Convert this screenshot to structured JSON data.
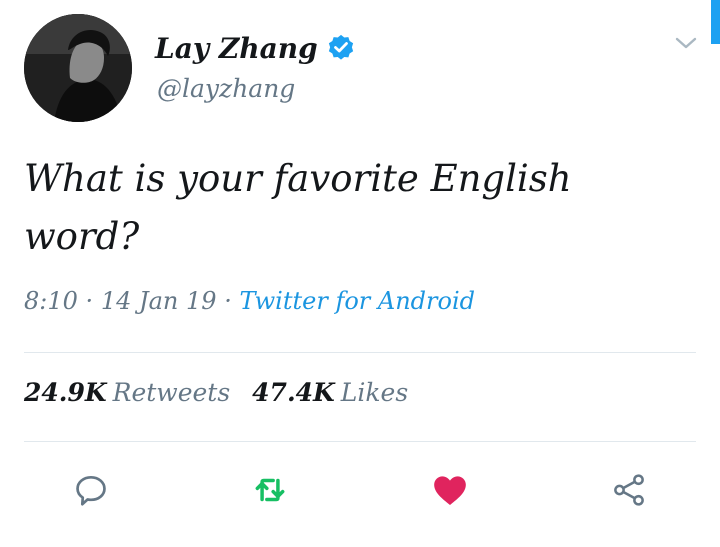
{
  "tweet": {
    "author": {
      "display_name": "Lay Zhang",
      "handle": "@layzhang",
      "verified": true,
      "avatar_icon": "profile-photo"
    },
    "text": "What is your favorite English word?",
    "time": "8:10",
    "date": "14 Jan 19",
    "separator": "·",
    "source": "Twitter for Android",
    "stats": {
      "retweets_count": "24.9K",
      "retweets_label": "Retweets",
      "likes_count": "47.4K",
      "likes_label": "Likes"
    },
    "liked": true
  },
  "actions": [
    {
      "name": "reply",
      "icon": "speech-bubble-icon"
    },
    {
      "name": "retweet",
      "icon": "retweet-icon",
      "active": true
    },
    {
      "name": "like",
      "icon": "heart-icon",
      "active": true
    },
    {
      "name": "share",
      "icon": "share-icon"
    }
  ],
  "colors": {
    "accent": "#1da1f2",
    "retweet_green": "#17bf63",
    "like_red": "#e0245e",
    "secondary_text": "#657786",
    "divider": "#e1e8ed"
  }
}
